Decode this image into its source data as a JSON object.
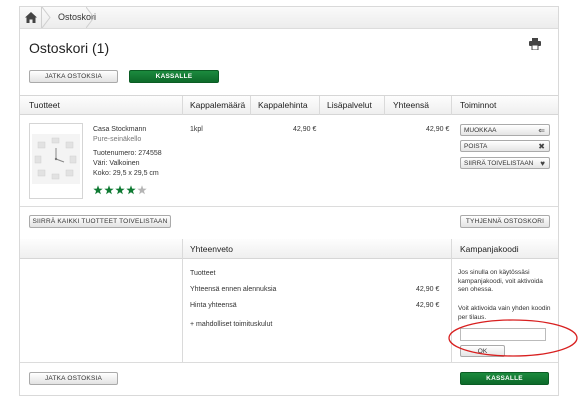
{
  "breadcrumb": {
    "current": "Ostoskori"
  },
  "page": {
    "title": "Ostoskori (1)"
  },
  "top_buttons": {
    "continue": "JATKA OSTOKSIA",
    "checkout": "KASSALLE"
  },
  "table": {
    "headers": [
      "Tuotteet",
      "Kappalemäärä",
      "Kappalehinta",
      "Lisäpalvelut",
      "Yhteensä",
      "Toiminnot"
    ]
  },
  "product": {
    "brand": "Casa Stockmann",
    "name": "Pure-seinäkello",
    "number": "Tuotenumero: 274558",
    "color": "Väri: Valkoinen",
    "size": "Koko: 29,5 x 29,5 cm",
    "rating": 4,
    "rating_max": 5,
    "quantity": "1kpl",
    "unit_price": "42,90 €",
    "total": "42,90 €"
  },
  "actions": {
    "edit": "MUOKKAA",
    "delete": "POISTA",
    "move_wishlist": "SIIRRÄ TOIVELISTAAN"
  },
  "bulk": {
    "move_all": "SIIRRÄ KAIKKI TUOTTEET TOIVELISTAAN",
    "empty": "TYHJENNÄ OSTOSKORI"
  },
  "summary": {
    "heading": "Yhteenveto",
    "products_label": "Tuotteet",
    "before_discount_label": "Yhteensä ennen alennuksia",
    "before_discount_value": "42,90 €",
    "total_label": "Hinta yhteensä",
    "total_value": "42,90 €",
    "shipping_note": "+ mahdolliset toimituskulut"
  },
  "campaign": {
    "heading": "Kampanjakoodi",
    "text1": "Jos sinulla on käytössäsi kampanjakoodi, voit aktivoida sen ohessa.",
    "text2": "Voit aktivoida vain yhden koodin per tilaus.",
    "input_value": "",
    "ok": "OK"
  },
  "bottom_buttons": {
    "continue": "JATKA OSTOKSIA",
    "checkout": "KASSALLE"
  },
  "colors": {
    "accent_green": "#0f7a33",
    "annotation_red": "#d81f1f",
    "star_grey": "#b5b5b5"
  }
}
